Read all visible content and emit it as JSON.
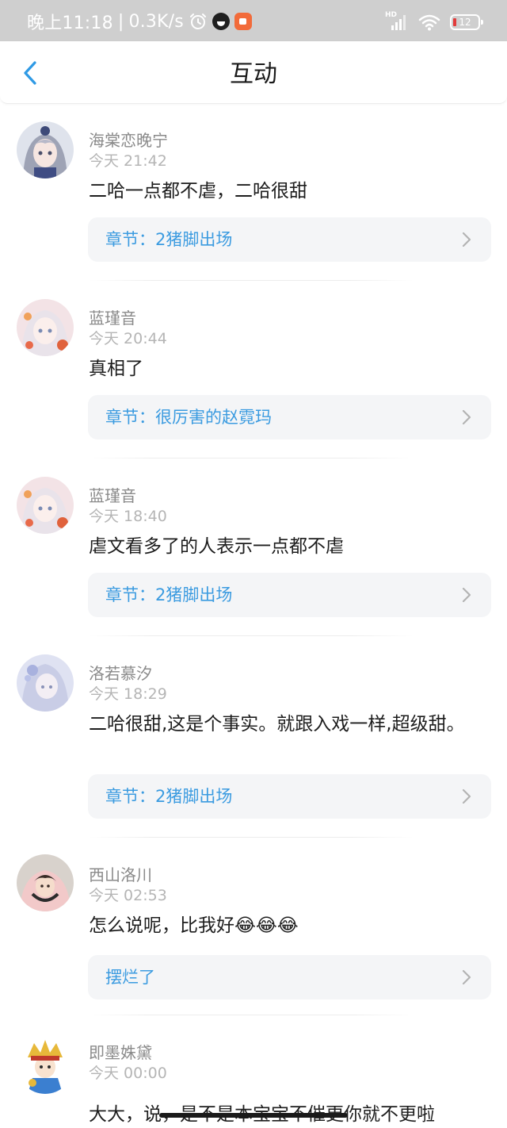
{
  "status_bar": {
    "time": "晚上11:18",
    "separator": "|",
    "net_speed": "0.3K/s",
    "alarm_icon": "alarm-clock-icon",
    "qq_icon": "qq-penguin-icon",
    "video_icon": "video-app-icon",
    "hd_label": "HD",
    "signal_icon": "signal-bars-icon",
    "wifi_icon": "wifi-icon",
    "battery_level": "12",
    "battery_low_color": "#e23b3b"
  },
  "header": {
    "back_icon": "chevron-left-icon",
    "title": "互动",
    "accent": "#2f9ae5"
  },
  "comments": [
    {
      "user": "海棠恋晚宁",
      "time": "今天 21:42",
      "text": "二哈一点都不虐，二哈很甜",
      "chapter": "章节：2猪脚出场",
      "avatar": "anime-girl-avatar"
    },
    {
      "user": "蓝瑾音",
      "time": "今天 20:44",
      "text": "真相了",
      "chapter": "章节：很厉害的赵霓玛",
      "avatar": "anime-girl-avatar"
    },
    {
      "user": "蓝瑾音",
      "time": "今天 18:40",
      "text": "虐文看多了的人表示一点都不虐",
      "chapter": "章节：2猪脚出场",
      "avatar": "anime-girl-avatar"
    },
    {
      "user": "洛若慕汐",
      "time": "今天 18:29",
      "text": "二哈很甜,这是个事实。就跟入戏一样,超级甜。",
      "chapter": "章节：2猪脚出场",
      "avatar": "anime-girl-avatar"
    },
    {
      "user": "西山洛川",
      "time": "今天 02:53",
      "text": "怎么说呢，比我好😂😂😂",
      "chapter": "摆烂了",
      "avatar": "photo-avatar"
    },
    {
      "user": "即墨姝黛",
      "time": "今天 00:00",
      "text": "大大，说，是不是本宝宝不催更你就不更啦",
      "chapter": "",
      "avatar": "opera-figure-avatar"
    }
  ],
  "colors": {
    "link": "#3b9be0",
    "chapter_bg": "#f4f5f7",
    "username": "#8a8a8a",
    "timestamp": "#b5b5b5",
    "status_bar_bg": "#cfcfcf"
  }
}
